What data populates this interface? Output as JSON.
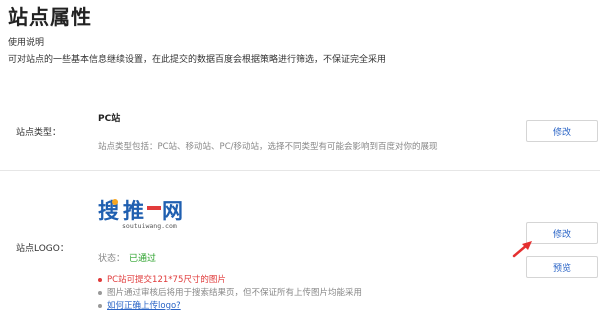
{
  "page": {
    "title": "站点属性",
    "usage_title": "使用说明",
    "usage_desc": "可对站点的一些基本信息继续设置，在此提交的数据百度会根据策略进行筛选，不保证完全采用"
  },
  "site_type": {
    "label": "站点类型：",
    "value": "PC站",
    "description": "站点类型包括：PC站、移动站、PC/移动站，选择不同类型有可能会影响到百度对你的展现",
    "edit_button": "修改"
  },
  "site_logo": {
    "label": "站点LOGO：",
    "logo_text": "搜推一网",
    "logo_url_text": "soutuiwang.com",
    "status_label": "状态：",
    "status_value": "已通过",
    "status_color": "#2aa12a",
    "notes": [
      {
        "text": "PC站可提交121*75尺寸的图片",
        "color": "#e03a3a"
      },
      {
        "text": "图片通过审核后将用于搜索结果页，但不保证所有上传图片均能采用",
        "color": "#888888"
      }
    ],
    "help_link": "如何正确上传logo?",
    "edit_button": "修改",
    "preview_button": "预览"
  },
  "colors": {
    "accent": "#2a64c6",
    "annotation_arrow": "#e53030"
  }
}
